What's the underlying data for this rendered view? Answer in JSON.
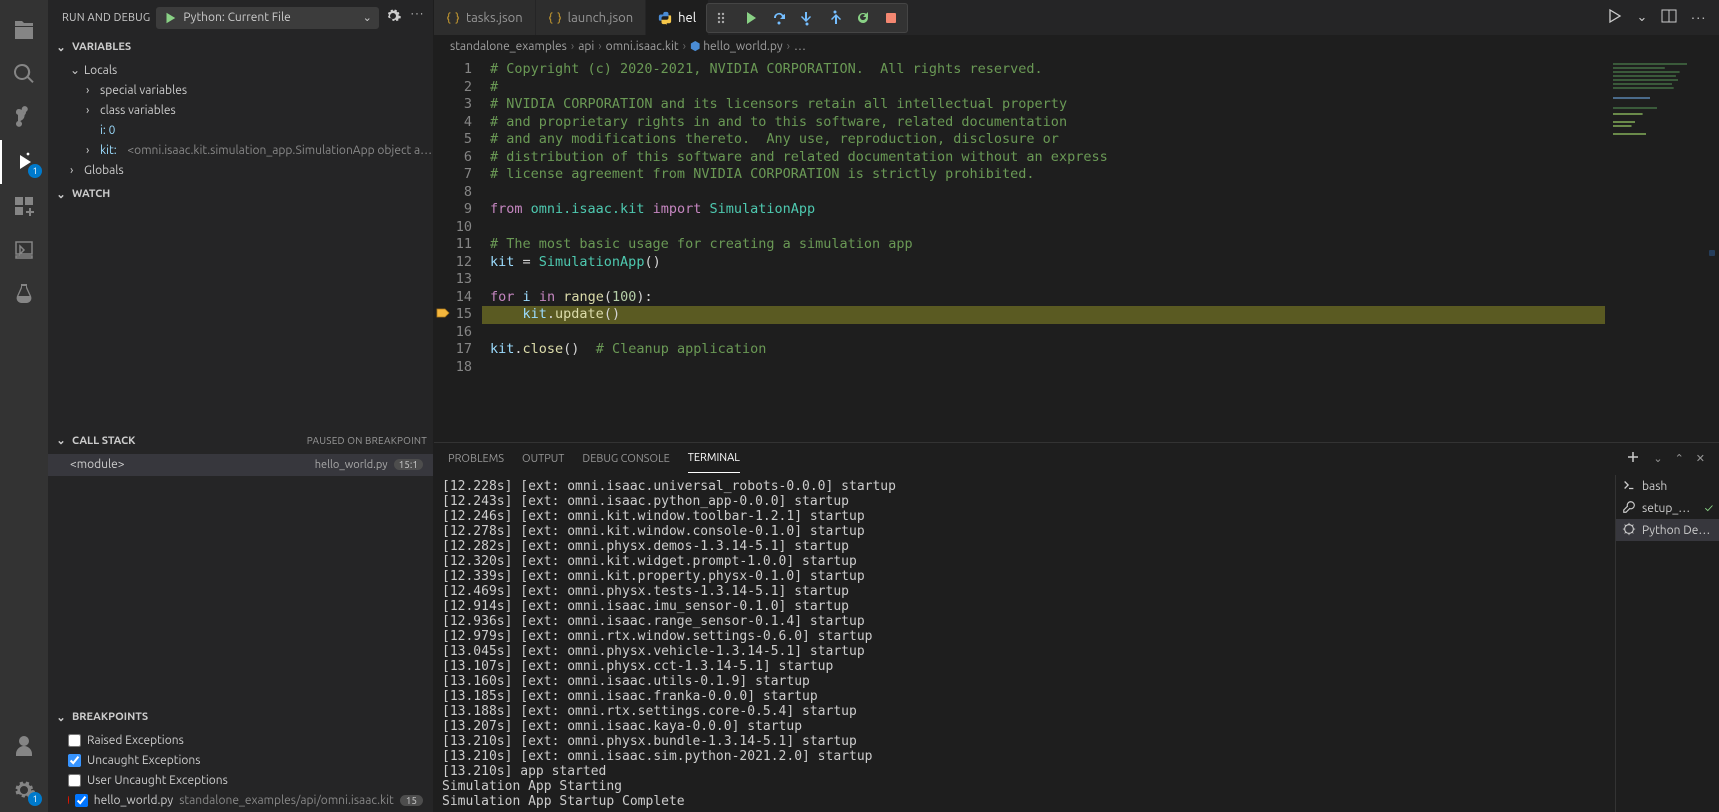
{
  "activity_bar": {
    "items": [
      {
        "name": "explorer-icon"
      },
      {
        "name": "search-icon"
      },
      {
        "name": "scm-icon"
      },
      {
        "name": "run-debug-icon",
        "active": true,
        "badge": "1"
      },
      {
        "name": "extensions-icon"
      },
      {
        "name": "remote-icon"
      },
      {
        "name": "testing-icon"
      }
    ],
    "bottom": [
      {
        "name": "accounts-icon"
      },
      {
        "name": "settings-icon",
        "badge": "1"
      }
    ]
  },
  "run_debug": {
    "title": "RUN AND DEBUG",
    "config": "Python: Current File"
  },
  "variables": {
    "title": "VARIABLES",
    "scope": "Locals",
    "rows": [
      {
        "label": "special variables",
        "twisty": ">"
      },
      {
        "label": "class variables",
        "twisty": ">"
      },
      {
        "label": "i: 0",
        "twisty": ""
      },
      {
        "label": "kit:",
        "value": "<omni.isaac.kit.simulation_app.SimulationApp object a…",
        "twisty": ">"
      }
    ],
    "globals": "Globals"
  },
  "watch": {
    "title": "WATCH"
  },
  "callstack": {
    "title": "CALL STACK",
    "status": "PAUSED ON BREAKPOINT",
    "frame": {
      "name": "<module>",
      "file": "hello_world.py",
      "loc": "15:1"
    }
  },
  "breakpoints": {
    "title": "BREAKPOINTS",
    "options": [
      {
        "label": "Raised Exceptions",
        "checked": false
      },
      {
        "label": "Uncaught Exceptions",
        "checked": true
      },
      {
        "label": "User Uncaught Exceptions",
        "checked": false
      }
    ],
    "file": {
      "name": "hello_world.py",
      "path": "standalone_examples/api/omni.isaac.kit",
      "line": "15",
      "checked": true
    }
  },
  "tabs": [
    {
      "icon": "json",
      "label": "tasks.json"
    },
    {
      "icon": "json",
      "label": "launch.json"
    },
    {
      "icon": "py",
      "label": "hel",
      "active": true
    }
  ],
  "breadcrumbs": [
    "standalone_examples",
    "api",
    "omni.isaac.kit",
    "hello_world.py",
    "…"
  ],
  "editor": {
    "breakpoint_line": 15,
    "highlight_line": 15,
    "lines": [
      {
        "n": 1,
        "t": "comment",
        "s": "# Copyright (c) 2020-2021, NVIDIA CORPORATION.  All rights reserved."
      },
      {
        "n": 2,
        "t": "comment",
        "s": "#"
      },
      {
        "n": 3,
        "t": "comment",
        "s": "# NVIDIA CORPORATION and its licensors retain all intellectual property"
      },
      {
        "n": 4,
        "t": "comment",
        "s": "# and proprietary rights in and to this software, related documentation"
      },
      {
        "n": 5,
        "t": "comment",
        "s": "# and any modifications thereto.  Any use, reproduction, disclosure or"
      },
      {
        "n": 6,
        "t": "comment",
        "s": "# distribution of this software and related documentation without an express"
      },
      {
        "n": 7,
        "t": "comment",
        "s": "# license agreement from NVIDIA CORPORATION is strictly prohibited."
      },
      {
        "n": 8,
        "t": "blank",
        "s": ""
      },
      {
        "n": 9,
        "t": "import"
      },
      {
        "n": 10,
        "t": "blank",
        "s": ""
      },
      {
        "n": 11,
        "t": "comment",
        "s": "# The most basic usage for creating a simulation app"
      },
      {
        "n": 12,
        "t": "assign"
      },
      {
        "n": 13,
        "t": "blank",
        "s": ""
      },
      {
        "n": 14,
        "t": "for"
      },
      {
        "n": 15,
        "t": "update"
      },
      {
        "n": 16,
        "t": "blank",
        "s": ""
      },
      {
        "n": 17,
        "t": "close"
      },
      {
        "n": 18,
        "t": "blank",
        "s": ""
      }
    ],
    "tokens": {
      "import_from": "from",
      "import_mod": "omni.isaac.kit",
      "import_kw": "import",
      "import_cls": "SimulationApp",
      "assign_var": "kit",
      "assign_eq": " = ",
      "assign_cls": "SimulationApp",
      "assign_par": "()",
      "for_kw": "for",
      "for_var": "i",
      "for_in": "in",
      "for_range": "range",
      "for_open": "(",
      "for_num": "100",
      "for_close": "):",
      "upd_indent": "    ",
      "upd_obj": "kit",
      "upd_dot": ".",
      "upd_fn": "update",
      "upd_par": "()",
      "close_obj": "kit",
      "close_dot": ".",
      "close_fn": "close",
      "close_par": "()",
      "close_sp": "  ",
      "close_comment": "# Cleanup application"
    }
  },
  "panel": {
    "tabs": [
      "PROBLEMS",
      "OUTPUT",
      "DEBUG CONSOLE",
      "TERMINAL"
    ],
    "active": 3,
    "terminals": [
      {
        "icon": "bash",
        "label": "bash"
      },
      {
        "icon": "tool",
        "label": "setup_…",
        "check": true
      },
      {
        "icon": "debug",
        "label": "Python De…",
        "active": true
      }
    ],
    "lines": [
      "[12.228s] [ext: omni.isaac.universal_robots-0.0.0] startup",
      "[12.243s] [ext: omni.isaac.python_app-0.0.0] startup",
      "[12.246s] [ext: omni.kit.window.toolbar-1.2.1] startup",
      "[12.278s] [ext: omni.kit.window.console-0.1.0] startup",
      "[12.282s] [ext: omni.physx.demos-1.3.14-5.1] startup",
      "[12.320s] [ext: omni.kit.widget.prompt-1.0.0] startup",
      "[12.339s] [ext: omni.kit.property.physx-0.1.0] startup",
      "[12.469s] [ext: omni.physx.tests-1.3.14-5.1] startup",
      "[12.914s] [ext: omni.isaac.imu_sensor-0.1.0] startup",
      "[12.936s] [ext: omni.isaac.range_sensor-0.1.4] startup",
      "[12.979s] [ext: omni.rtx.window.settings-0.6.0] startup",
      "[13.045s] [ext: omni.physx.vehicle-1.3.14-5.1] startup",
      "[13.107s] [ext: omni.physx.cct-1.3.14-5.1] startup",
      "[13.160s] [ext: omni.isaac.utils-0.1.9] startup",
      "[13.185s] [ext: omni.isaac.franka-0.0.0] startup",
      "[13.188s] [ext: omni.rtx.settings.core-0.5.4] startup",
      "[13.207s] [ext: omni.isaac.kaya-0.0.0] startup",
      "[13.210s] [ext: omni.physx.bundle-1.3.14-5.1] startup",
      "[13.210s] [ext: omni.isaac.sim.python-2021.2.0] startup",
      "[13.210s] app started",
      "Simulation App Starting",
      "Simulation App Startup Complete"
    ]
  }
}
